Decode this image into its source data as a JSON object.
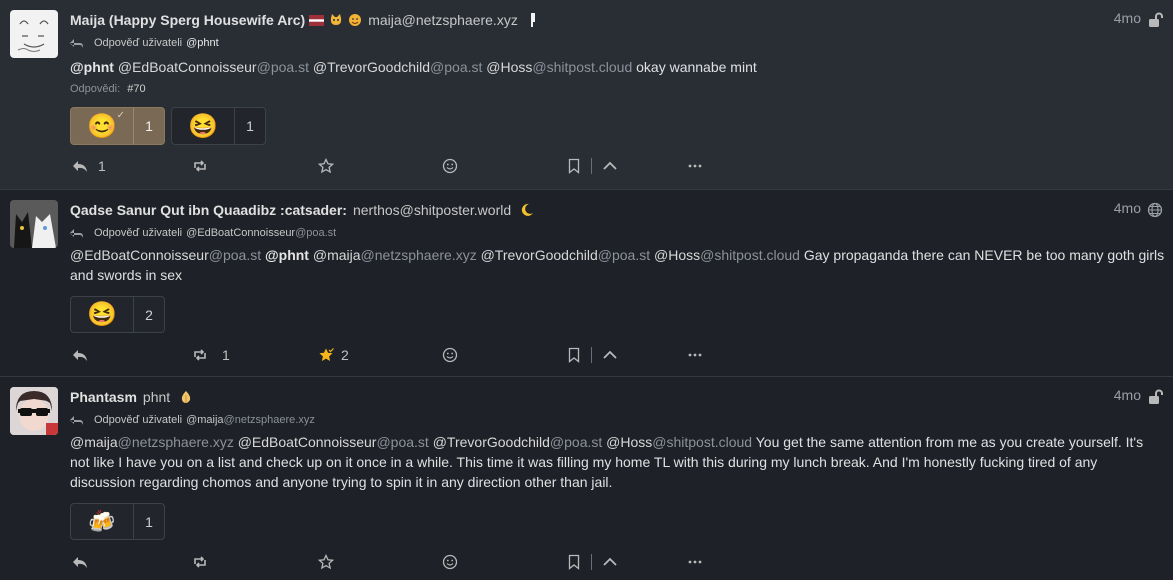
{
  "posts": [
    {
      "author_name": "Maija (Happy Sperg Housewife Arc)",
      "author_acct": "maija@netzsphaere.xyz",
      "time": "4mo",
      "reply_label": "Odpověď uživateli",
      "reply_target": "@phnt",
      "reply_target_host": "",
      "content": [
        {
          "t": "@phnt",
          "c": "mention-bold"
        },
        {
          "t": " "
        },
        {
          "t": "@EdBoatConnoisseur",
          "c": "mention"
        },
        {
          "t": "@poa.st",
          "c": "host"
        },
        {
          "t": " "
        },
        {
          "t": "@TrevorGoodchild",
          "c": "mention"
        },
        {
          "t": "@poa.st",
          "c": "host"
        },
        {
          "t": " "
        },
        {
          "t": "@Hoss",
          "c": "mention"
        },
        {
          "t": "@shitpost.cloud",
          "c": "host"
        },
        {
          "t": " okay wannabe mint"
        }
      ],
      "replies_label": "Odpovědi:",
      "replies_value": "#70",
      "reactions": [
        {
          "emoji": "😊",
          "count": "1",
          "mine": true
        },
        {
          "emoji": "😆",
          "count": "1",
          "mine": false
        }
      ],
      "reply_count": "1",
      "repeat_count": "",
      "fav_count": ""
    },
    {
      "author_name": "Qadse Sanur Qut ibn Quaadibz :catsader:",
      "author_acct": "nerthos@shitposter.world",
      "time": "4mo",
      "reply_label": "Odpověď uživateli",
      "reply_target": "@EdBoatConnoisseur",
      "reply_target_host": "@poa.st",
      "content": [
        {
          "t": "@EdBoatConnoisseur",
          "c": "mention"
        },
        {
          "t": "@poa.st",
          "c": "host"
        },
        {
          "t": " "
        },
        {
          "t": "@phnt",
          "c": "mention-bold"
        },
        {
          "t": " "
        },
        {
          "t": "@maija",
          "c": "mention"
        },
        {
          "t": "@netzsphaere.xyz",
          "c": "host"
        },
        {
          "t": " "
        },
        {
          "t": "@TrevorGoodchild",
          "c": "mention"
        },
        {
          "t": "@poa.st",
          "c": "host"
        },
        {
          "t": " "
        },
        {
          "t": "@Hoss",
          "c": "mention"
        },
        {
          "t": "@shitpost.cloud",
          "c": "host"
        },
        {
          "t": " Gay propaganda there can NEVER be too many goth girls and swords in sex"
        }
      ],
      "reactions": [
        {
          "emoji": "😆",
          "count": "2",
          "mine": false
        }
      ],
      "reply_count": "",
      "repeat_count": "1",
      "fav_count": "2"
    },
    {
      "author_name": "Phantasm",
      "author_acct": "phnt",
      "time": "4mo",
      "reply_label": "Odpověď uživateli",
      "reply_target": "@maija",
      "reply_target_host": "@netzsphaere.xyz",
      "content": [
        {
          "t": "@maija",
          "c": "mention"
        },
        {
          "t": "@netzsphaere.xyz",
          "c": "host"
        },
        {
          "t": " "
        },
        {
          "t": "@EdBoatConnoisseur",
          "c": "mention"
        },
        {
          "t": "@poa.st",
          "c": "host"
        },
        {
          "t": " "
        },
        {
          "t": "@TrevorGoodchild",
          "c": "mention"
        },
        {
          "t": "@poa.st",
          "c": "host"
        },
        {
          "t": " "
        },
        {
          "t": "@Hoss",
          "c": "mention"
        },
        {
          "t": "@shitpost.cloud",
          "c": "host"
        },
        {
          "t": " You get the same attention from me as you create yourself. It's not like I have you on a list and check up on it once in a while. This time it was filling my home TL with this during my lunch break. And I'm honestly fucking tired of any discussion regarding chomos and anyone trying to spin it in any direction other than jail."
        }
      ],
      "reactions": [
        {
          "emoji": "🍻",
          "count": "1",
          "mine": false
        }
      ],
      "reply_count": "",
      "repeat_count": "",
      "fav_count": ""
    }
  ],
  "colors": {
    "background": "#1e2127",
    "highlight": "#292e35",
    "accent": "#f5b51b"
  }
}
